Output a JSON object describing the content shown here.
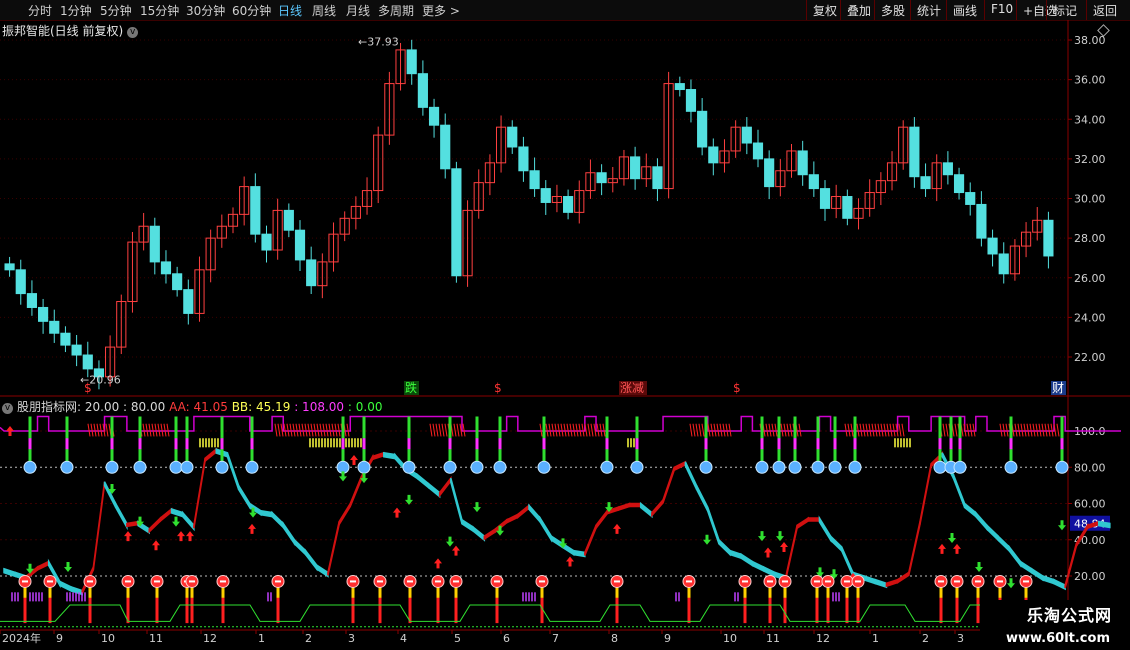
{
  "toolbar": {
    "periods": [
      "分时",
      "1分钟",
      "5分钟",
      "15分钟",
      "30分钟",
      "60分钟",
      "日线",
      "周线",
      "月线",
      "多周期",
      "更多 >"
    ],
    "active": "日线",
    "right_items": [
      "复权",
      "叠加",
      "多股",
      "统计",
      "画线",
      "F10",
      "+自选",
      "返回"
    ],
    "right_mark": "标记"
  },
  "stock": {
    "title": "振邦智能(日线 前复权)"
  },
  "price_chart": {
    "y_ticks": [
      "38.00",
      "36.00",
      "34.00",
      "32.00",
      "30.00",
      "28.00",
      "26.00",
      "24.00",
      "22.00"
    ],
    "high_label": "37.93",
    "low_label": "20.96",
    "markers": [
      {
        "text": "$",
        "color": "#ff3333"
      },
      {
        "text": "跌",
        "color": "#3cff3c",
        "bg": "#0a4a0a"
      },
      {
        "text": "$",
        "color": "#ff3333"
      },
      {
        "text": "涨减",
        "color": "#ff5555",
        "bg": "#5a0a0a"
      },
      {
        "text": "$",
        "color": "#ff3333"
      },
      {
        "text": "财",
        "color": "#ffffff",
        "bg": "#1a3a8a"
      }
    ]
  },
  "indicator": {
    "name": "股朋指标网",
    "params": ": 20.00 : 80.00",
    "aa_label": "AA: 41.05",
    "bb_label": "BB: 45.19",
    "mag_label": ": 108.00",
    "grn_label": ": 0.00",
    "y_ticks": [
      "100.0",
      "80.00",
      "60.00",
      "40.00",
      "20.00"
    ],
    "current_value": "48.84"
  },
  "x_axis": {
    "labels": [
      "2024年",
      "9",
      "10",
      "11",
      "12",
      "1",
      "2",
      "3",
      "4",
      "5",
      "6",
      "7",
      "8",
      "9",
      "10",
      "11",
      "12",
      "1",
      "2",
      "3"
    ]
  },
  "watermark": {
    "line1": "乐淘公式网",
    "line2": "www.60lt.com"
  },
  "chart_data": {
    "type": "candlestick",
    "title": "振邦智能(日线 前复权)",
    "price_ylim": [
      21,
      39
    ],
    "price_high": 37.93,
    "price_low": 20.96,
    "close_series": [
      26.4,
      25.2,
      24.5,
      23.8,
      23.2,
      22.6,
      22.1,
      21.4,
      21.0,
      22.5,
      24.8,
      27.8,
      28.6,
      26.8,
      26.2,
      25.4,
      24.2,
      26.4,
      28.0,
      28.6,
      29.2,
      30.6,
      28.2,
      27.4,
      29.4,
      28.4,
      26.9,
      25.6,
      26.8,
      28.2,
      29.0,
      29.6,
      30.4,
      33.2,
      35.8,
      37.5,
      36.3,
      34.6,
      33.7,
      31.5,
      26.1,
      29.4,
      30.8,
      31.8,
      33.6,
      32.6,
      31.4,
      30.5,
      29.8,
      30.1,
      29.3,
      30.4,
      31.3,
      30.8,
      31.0,
      32.1,
      31.0,
      31.6,
      30.5,
      35.8,
      35.5,
      34.4,
      32.6,
      31.8,
      32.4,
      33.6,
      32.8,
      32.0,
      30.6,
      31.4,
      32.4,
      31.2,
      30.5,
      29.5,
      30.1,
      29.0,
      29.5,
      30.3,
      30.9,
      31.8,
      33.6,
      31.1,
      30.5,
      31.8,
      31.2,
      30.3,
      29.7,
      28.0,
      27.2,
      26.2,
      27.6,
      28.3,
      28.9,
      27.1
    ],
    "indicator_ylim": [
      0,
      118
    ],
    "aa": 41.05,
    "bb": 45.19,
    "line_top": 108.0,
    "line_bottom": 0.0,
    "levels": [
      20,
      80
    ],
    "indicator_series": [
      24,
      22,
      20,
      25,
      28,
      17,
      14,
      12,
      25,
      72,
      60,
      49,
      50,
      46,
      52,
      57,
      55,
      48,
      85,
      90,
      88,
      70,
      60,
      56,
      55,
      49,
      40,
      34,
      26,
      22,
      50,
      60,
      75,
      86,
      88,
      87,
      80,
      76,
      71,
      66,
      74,
      51,
      47,
      42,
      46,
      51,
      54,
      59,
      52,
      42,
      38,
      34,
      33,
      48,
      56,
      58,
      60,
      60,
      55,
      62,
      80,
      83,
      70,
      58,
      40,
      34,
      32,
      28,
      25,
      22,
      20,
      48,
      52,
      52,
      42,
      36,
      22,
      20,
      18,
      16,
      18,
      22,
      50,
      82,
      88,
      76,
      60,
      55,
      48,
      42,
      36,
      28,
      24,
      20,
      18,
      15,
      38,
      48,
      50,
      49
    ]
  }
}
